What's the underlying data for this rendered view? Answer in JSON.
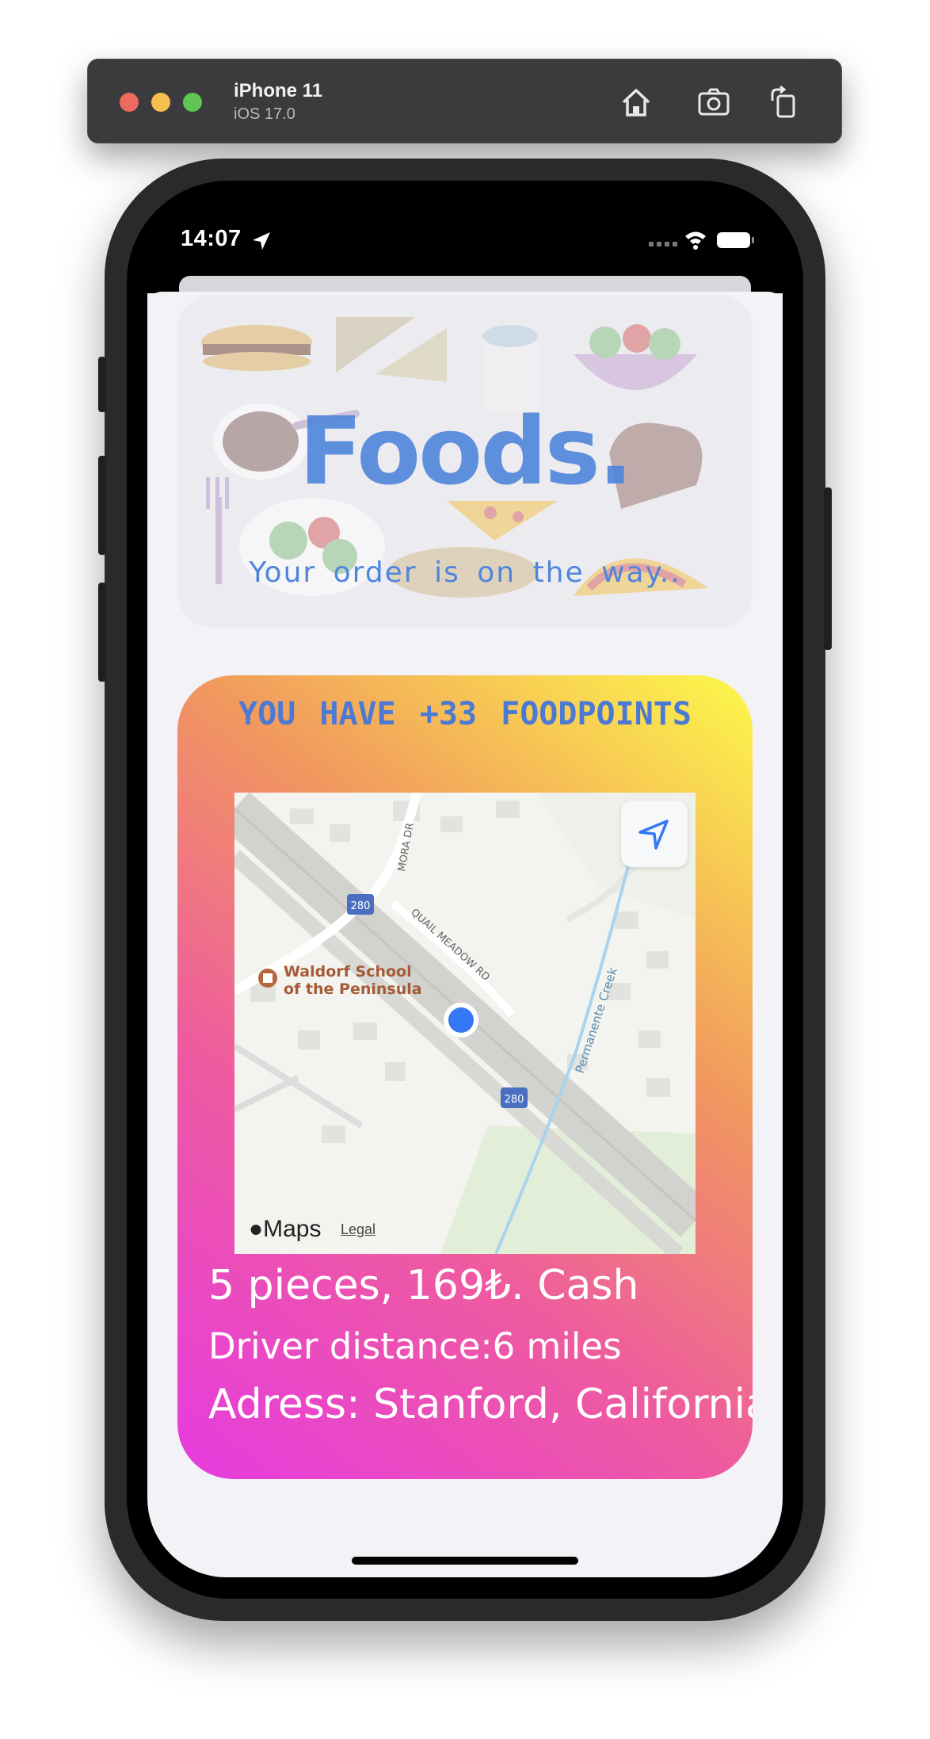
{
  "simulator": {
    "device": "iPhone 11",
    "os": "iOS 17.0",
    "buttons": [
      "home-icon",
      "screenshot-icon",
      "rotate-icon"
    ]
  },
  "status_bar": {
    "time": "14:07",
    "icons": [
      "location-arrow-icon",
      "signal-icon",
      "wifi-icon",
      "battery-icon"
    ]
  },
  "header": {
    "title": "Foods.",
    "subtitle": "Your order is on the way.."
  },
  "order": {
    "points_text": "YOU HAVE +33 FOODPOINTS",
    "summary": "5 pieces, 169₺. Cash",
    "driver_distance": "Driver distance:6 miles",
    "address": "Adress: Stanford, California"
  },
  "map": {
    "poi_line1": "Waldorf School",
    "poi_line2": "of the Peninsula",
    "road_mora": "MORA DR",
    "road_quail": "QUAIL MEADOW RD",
    "creek": "Permanente Creek",
    "highway_shield": "280",
    "brand": "Maps",
    "legal": "Legal"
  },
  "colors": {
    "accent_blue": "#4f86db",
    "gradient_start": "#e63be0",
    "gradient_end": "#fdf94a",
    "user_dot": "#3478f6"
  }
}
